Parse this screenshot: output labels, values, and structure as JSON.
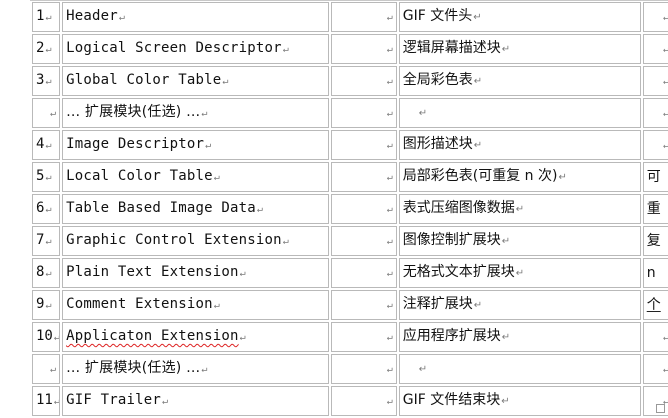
{
  "pilcrow": "↵",
  "rows": [
    {
      "num": "1",
      "name": "Header",
      "cn": "GIF 文件头",
      "extra": ""
    },
    {
      "num": "2",
      "name": "Logical Screen Descriptor",
      "cn": "逻辑屏幕描述块",
      "extra": ""
    },
    {
      "num": "3",
      "name": "Global Color Table",
      "cn": "全局彩色表",
      "extra": ""
    },
    {
      "num": "",
      "name": "… 扩展模块(任选) …",
      "cn": "",
      "extra": ""
    },
    {
      "num": "4",
      "name": "Image Descriptor",
      "cn": "图形描述块",
      "extra": ""
    },
    {
      "num": "5",
      "name": "Local Color Table",
      "cn": "局部彩色表(可重复 n 次)",
      "extra": "可"
    },
    {
      "num": "6",
      "name": "Table Based Image Data",
      "cn": "表式压缩图像数据",
      "extra": "重"
    },
    {
      "num": "7",
      "name": "Graphic Control Extension",
      "cn": "图像控制扩展块",
      "extra": "复"
    },
    {
      "num": "8",
      "name": "Plain Text Extension",
      "cn": "无格式文本扩展块",
      "extra": "n"
    },
    {
      "num": "9",
      "name": "Comment Extension",
      "cn": "注释扩展块",
      "extra": "个"
    },
    {
      "num": "10",
      "name": "Applicaton Extension",
      "cn": "应用程序扩展块",
      "extra": ""
    },
    {
      "num": "",
      "name": "… 扩展模块(任选) …",
      "cn": "",
      "extra": ""
    },
    {
      "num": "11",
      "name": "GIF Trailer",
      "cn": "GIF 文件结束块",
      "extra": ""
    }
  ]
}
